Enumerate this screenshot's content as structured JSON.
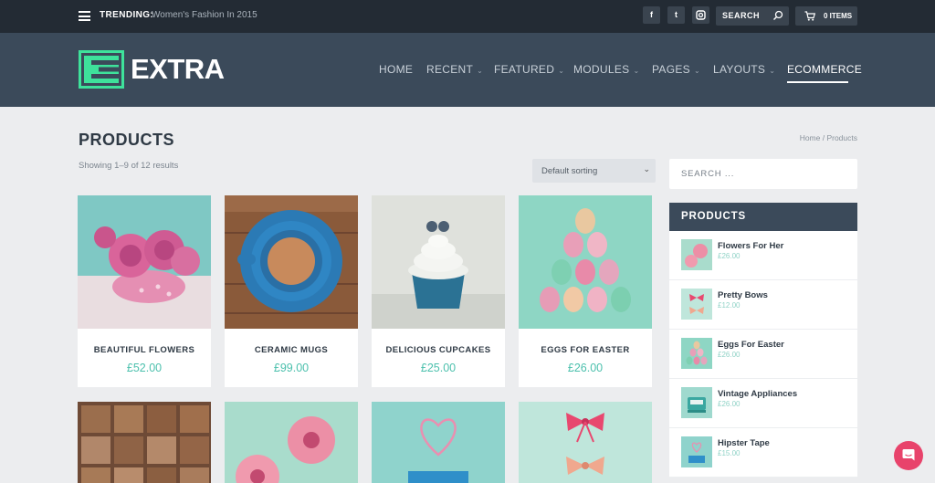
{
  "topbar": {
    "trending_label": "TRENDING:",
    "trending_text": "Women's Fashion In 2015",
    "social": [
      {
        "icon": "facebook-icon",
        "glyph": "f"
      },
      {
        "icon": "twitter-icon",
        "glyph": "t"
      },
      {
        "icon": "instagram-icon",
        "glyph": "◻"
      }
    ],
    "search_label": "SEARCH",
    "cart_label": "0 ITEMS"
  },
  "header": {
    "logo_text": "EXTRA",
    "nav": [
      {
        "label": "HOME",
        "has_dropdown": false
      },
      {
        "label": "RECENT",
        "has_dropdown": true
      },
      {
        "label": "FEATURED",
        "has_dropdown": true
      },
      {
        "label": "MODULES",
        "has_dropdown": true
      },
      {
        "label": "PAGES",
        "has_dropdown": true
      },
      {
        "label": "LAYOUTS",
        "has_dropdown": true
      },
      {
        "label": "ECOMMERCE",
        "has_dropdown": false,
        "active": true
      }
    ]
  },
  "main": {
    "title": "PRODUCTS",
    "breadcrumb": "Home / Products",
    "result_count": "Showing 1–9 of 12 results",
    "sort_value": "Default sorting",
    "products": [
      {
        "name": "BEAUTIFUL FLOWERS",
        "price": "£52.00"
      },
      {
        "name": "CERAMIC MUGS",
        "price": "£99.00"
      },
      {
        "name": "DELICIOUS CUPCAKES",
        "price": "£25.00"
      },
      {
        "name": "EGGS FOR EASTER",
        "price": "£26.00"
      }
    ]
  },
  "sidebar": {
    "search_placeholder": "SEARCH ...",
    "widget_title": "PRODUCTS",
    "items": [
      {
        "name": "Flowers For Her",
        "price": "£26.00"
      },
      {
        "name": "Pretty Bows",
        "price": "£12.00"
      },
      {
        "name": "Eggs For Easter",
        "price": "£26.00"
      },
      {
        "name": "Vintage Appliances",
        "price": "£26.00"
      },
      {
        "name": "Hipster Tape",
        "price": "£15.00"
      }
    ]
  },
  "colors": {
    "topbar_bg": "#232b34",
    "header_bg": "#3b4a5a",
    "accent": "#4cc0ad",
    "logo_green": "#3ee29b",
    "chat": "#e8436b"
  }
}
